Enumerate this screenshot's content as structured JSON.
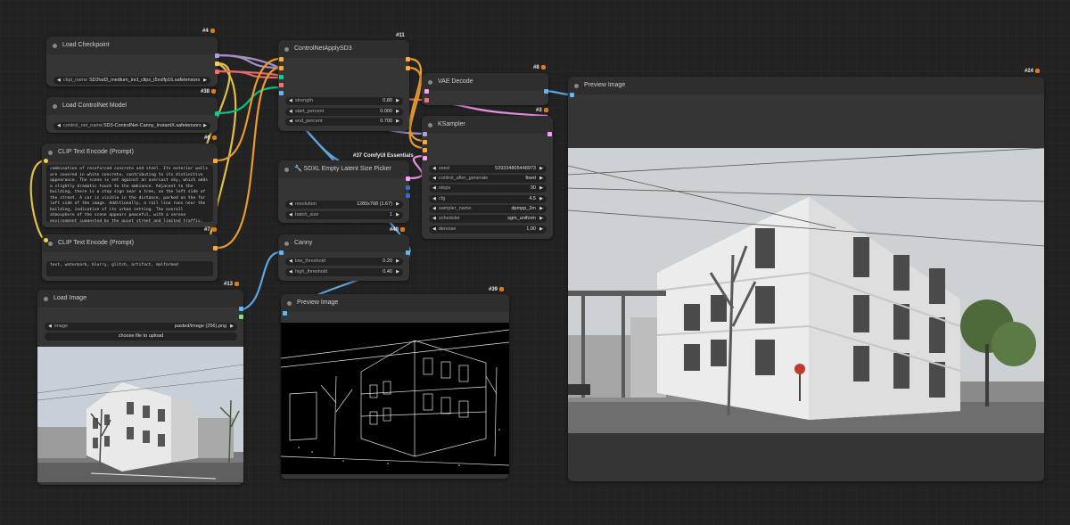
{
  "nodes": {
    "load_checkpoint": {
      "id": "#4",
      "title": "Load Checkpoint",
      "ckpt_label": "ckpt_name",
      "ckpt_value": "SD3\\sd3_medium_incl_clips_t5xxlfp16.safetensors"
    },
    "load_controlnet": {
      "id": "#38",
      "title": "Load ControlNet Model",
      "cn_label": "control_net_name",
      "cn_value": "SD3-ControlNet-Canny_InstantX.safetensors"
    },
    "clip_positive": {
      "id": "#6",
      "title": "CLIP Text Encode (Prompt)",
      "text": "combination of reinforced concrete and steel. Its exterior walls are covered in white concrete, contributing to its distinctive appearance. The scene is set against an overcast sky, which adds a slightly dramatic touch to the ambiance. Adjacent to the building, there is a stop sign near a tree, on the left side of the street. A car is visible in the distance, parked on the far left side of the image. Additionally, a rail line runs near the building, indicative of its urban setting. The overall atmosphere of the scene appears peaceful, with a serene environment suggested by the quiet street and limited traffic, nestled in a residential area surrounded by trees."
    },
    "clip_negative": {
      "id": "#7",
      "title": "CLIP Text Encode (Prompt)",
      "text": "text, watermark, blurry, glitch, artifact, malformed"
    },
    "load_image": {
      "id": "#13",
      "title": "Load Image",
      "image_label": "image",
      "image_value": "pasted/image (256).png",
      "upload_label": "choose file to upload"
    },
    "controlnet_apply": {
      "id": "#11",
      "title": "ControlNetApplySD3",
      "widgets": [
        {
          "label": "strength",
          "value": "0.80"
        },
        {
          "label": "start_percent",
          "value": "0.000"
        },
        {
          "label": "end_percent",
          "value": "0.700"
        }
      ]
    },
    "sdxl_picker": {
      "id": "#37 ComfyUI Essentials",
      "title": "🔧 SDXL Empty Latent Size Picker",
      "widgets": [
        {
          "label": "resolution",
          "value": "1280x768 (1.67)"
        },
        {
          "label": "batch_size",
          "value": "1"
        }
      ]
    },
    "canny": {
      "id": "#40",
      "title": "Canny",
      "widgets": [
        {
          "label": "low_threshold",
          "value": "0.20"
        },
        {
          "label": "high_threshold",
          "value": "0.40"
        }
      ]
    },
    "preview_small": {
      "id": "#39",
      "title": "Preview Image"
    },
    "vae_decode": {
      "id": "#8",
      "title": "VAE Decode"
    },
    "ksampler": {
      "id": "#3",
      "title": "KSampler",
      "widgets": [
        {
          "label": "seed",
          "value": "539334805448973"
        },
        {
          "label": "control_after_generate",
          "value": "fixed"
        },
        {
          "label": "steps",
          "value": "30"
        },
        {
          "label": "cfg",
          "value": "4.5"
        },
        {
          "label": "sampler_name",
          "value": "dpmpp_2m"
        },
        {
          "label": "scheduler",
          "value": "sgm_uniform"
        },
        {
          "label": "denoise",
          "value": "1.00"
        }
      ]
    },
    "preview_large": {
      "id": "#24",
      "title": "Preview Image"
    }
  },
  "colors": {
    "canvas": "#222222",
    "node_body": "#353535",
    "node_title": "#2e2e2e",
    "model_wire": "#b39ddb",
    "clip_wire": "#f6d04d",
    "vae_wire": "#ff6e6e",
    "control_wire": "#00d68f",
    "image_wire": "#64b5f6",
    "latent_wire": "#ff9cf9",
    "conditioning_wire": "#ffa931"
  }
}
